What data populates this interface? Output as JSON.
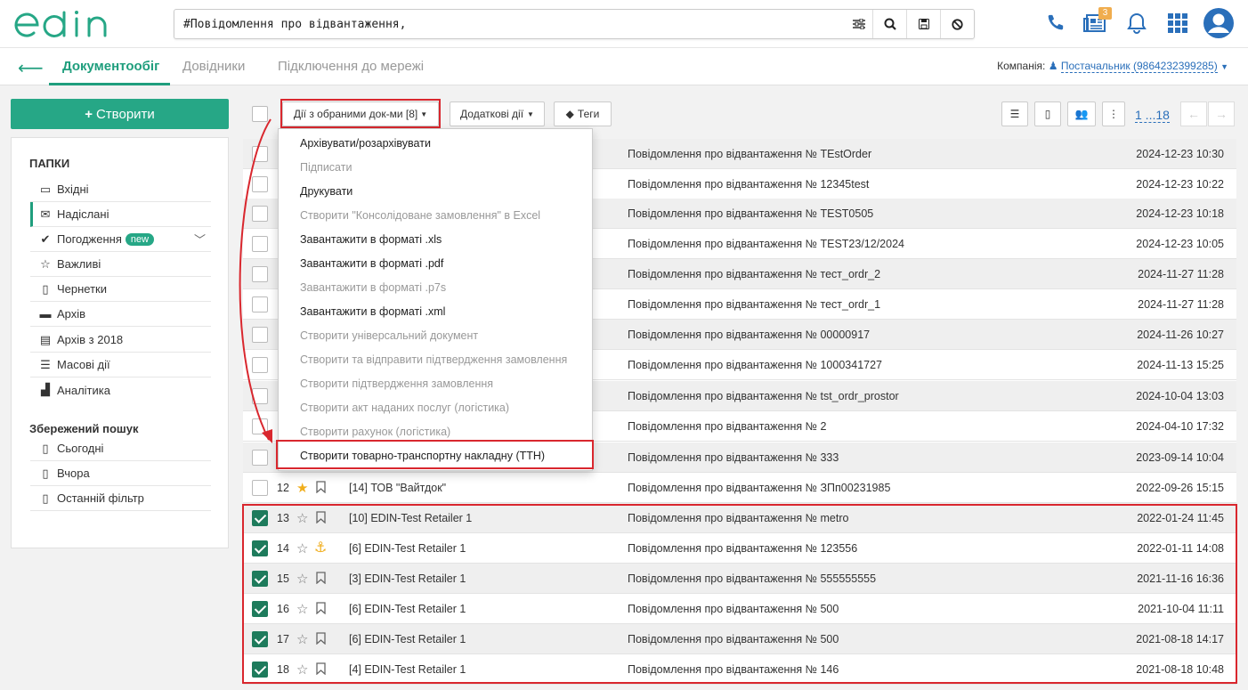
{
  "search": {
    "value": "#Повідомлення про відвантаження,"
  },
  "header": {
    "notifications_count": "3"
  },
  "nav": {
    "tabs": [
      "Документообіг",
      "Довідники",
      "Підключення до мережі"
    ],
    "company_label": "Компанія:",
    "company_value": "Постачальник (9864232399285)"
  },
  "sidebar": {
    "create_label": "Створити",
    "folders_title": "ПАПКИ",
    "items": [
      "Вхідні",
      "Надіслані",
      "Погодження",
      "Важливі",
      "Чернетки",
      "Архів",
      "Архів з 2018",
      "Масові дії",
      "Аналітика"
    ],
    "new_badge": "new",
    "saved_title": "Збережений пошук",
    "saved_items": [
      "Сьогодні",
      "Вчора",
      "Останній фільтр"
    ]
  },
  "toolbar": {
    "actions_label": "Дії з обраними док-ми [8]",
    "extra_label": "Додаткові дії",
    "tags_label": "Теги",
    "pagination": "1 ...18"
  },
  "dropdown": {
    "items": [
      {
        "label": "Архівувати/розархівувати",
        "enabled": true
      },
      {
        "label": "Підписати",
        "enabled": false
      },
      {
        "label": "Друкувати",
        "enabled": true
      },
      {
        "label": "Створити \"Консолідоване замовлення\" в Excel",
        "enabled": false
      },
      {
        "label": "Завантажити в форматі .xls",
        "enabled": true
      },
      {
        "label": "Завантажити в форматі .pdf",
        "enabled": true
      },
      {
        "label": "Завантажити в форматі .p7s",
        "enabled": false
      },
      {
        "label": "Завантажити в форматі .xml",
        "enabled": true
      },
      {
        "label": "Створити універсальний документ",
        "enabled": false
      },
      {
        "label": "Створити та відправити підтвердження замовлення",
        "enabled": false
      },
      {
        "label": "Створити підтвердження замовлення",
        "enabled": false
      },
      {
        "label": "Створити акт наданих послуг (логістика)",
        "enabled": false
      },
      {
        "label": "Створити рахунок (логістика)",
        "enabled": false
      },
      {
        "label": "Створити товарно-транспортну накладну (ТТН)",
        "enabled": true
      }
    ]
  },
  "rows": [
    {
      "num": "",
      "sender": "",
      "subject": "Повідомлення про відвантаження № TEstOrder",
      "date": "2024-12-23 10:30",
      "checked": false
    },
    {
      "num": "",
      "sender": "",
      "subject": "Повідомлення про відвантаження № 12345test",
      "date": "2024-12-23 10:22",
      "checked": false
    },
    {
      "num": "",
      "sender": "",
      "subject": "Повідомлення про відвантаження № TEST0505",
      "date": "2024-12-23 10:18",
      "checked": false
    },
    {
      "num": "",
      "sender": "",
      "subject": "Повідомлення про відвантаження № TEST23/12/2024",
      "date": "2024-12-23 10:05",
      "checked": false
    },
    {
      "num": "",
      "sender": "",
      "subject": "Повідомлення про відвантаження № тест_ordr_2",
      "date": "2024-11-27 11:28",
      "checked": false
    },
    {
      "num": "",
      "sender": "",
      "subject": "Повідомлення про відвантаження № тест_ordr_1",
      "date": "2024-11-27 11:28",
      "checked": false
    },
    {
      "num": "",
      "sender": "",
      "subject": "Повідомлення про відвантаження № 00000917",
      "date": "2024-11-26 10:27",
      "checked": false
    },
    {
      "num": "",
      "sender": "",
      "subject": "Повідомлення про відвантаження № 1000341727",
      "date": "2024-11-13 15:25",
      "checked": false
    },
    {
      "num": "",
      "sender": "",
      "subject": "Повідомлення про відвантаження № tst_ordr_prostor",
      "date": "2024-10-04 13:03",
      "checked": false
    },
    {
      "num": "",
      "sender": "",
      "subject": "Повідомлення про відвантаження № 2",
      "date": "2024-04-10 17:32",
      "checked": false
    },
    {
      "num": "",
      "sender": "",
      "subject": "Повідомлення про відвантаження № 333",
      "date": "2023-09-14 10:04",
      "checked": false
    },
    {
      "num": "12",
      "sender": "[14] ТОВ \"Вайтдок\"",
      "subject": "Повідомлення про відвантаження № ЗПп00231985",
      "date": "2022-09-26 15:15",
      "checked": false
    },
    {
      "num": "13",
      "sender": "[10] EDIN-Test Retailer 1",
      "subject": "Повідомлення про відвантаження № metro",
      "date": "2022-01-24 11:45",
      "checked": true
    },
    {
      "num": "14",
      "sender": "[6] EDIN-Test Retailer 1",
      "subject": "Повідомлення про відвантаження № 123556",
      "date": "2022-01-11 14:08",
      "checked": true
    },
    {
      "num": "15",
      "sender": "[3] EDIN-Test Retailer 1",
      "subject": "Повідомлення про відвантаження № 555555555",
      "date": "2021-11-16 16:36",
      "checked": true
    },
    {
      "num": "16",
      "sender": "[6] EDIN-Test Retailer 1",
      "subject": "Повідомлення про відвантаження № 500",
      "date": "2021-10-04 11:11",
      "checked": true
    },
    {
      "num": "17",
      "sender": "[6] EDIN-Test Retailer 1",
      "subject": "Повідомлення про відвантаження № 500",
      "date": "2021-08-18 14:17",
      "checked": true
    },
    {
      "num": "18",
      "sender": "[4] EDIN-Test Retailer 1",
      "subject": "Повідомлення про відвантаження № 146",
      "date": "2021-08-18 10:48",
      "checked": true
    }
  ],
  "colors": {
    "accent": "#26a786",
    "highlight": "#d9272e",
    "link": "#2a6fba"
  }
}
